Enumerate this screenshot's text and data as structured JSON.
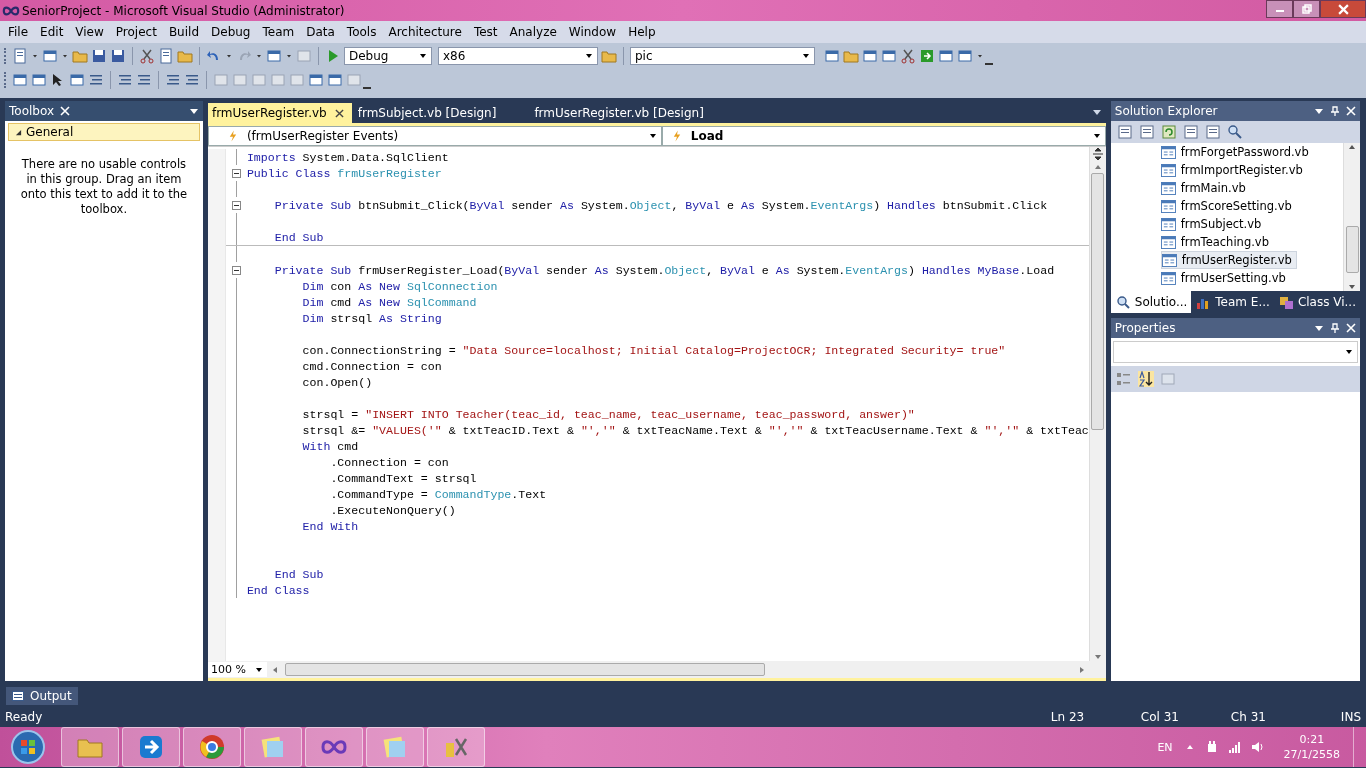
{
  "window": {
    "title": "SeniorProject - Microsoft Visual Studio (Administrator)"
  },
  "menu": [
    "File",
    "Edit",
    "View",
    "Project",
    "Build",
    "Debug",
    "Team",
    "Data",
    "Tools",
    "Architecture",
    "Test",
    "Analyze",
    "Window",
    "Help"
  ],
  "toolbar": {
    "configuration": "Debug",
    "platform": "x86",
    "find": "pic"
  },
  "toolbox": {
    "title": "Toolbox",
    "group": "General",
    "group_expanded": true,
    "message": "There are no usable controls in this group. Drag an item onto this text to add it to the toolbox."
  },
  "tabs": [
    {
      "label": "frmUserRegister.vb",
      "selected": true
    },
    {
      "label": "frmSubject.vb [Design]",
      "selected": false
    },
    {
      "label": "frmUserRegister.vb [Design]",
      "selected": false
    }
  ],
  "navigation": {
    "class_box": "(frmUserRegister Events)",
    "method_box": "Load"
  },
  "code": [
    {
      "fold": false,
      "tokens": [
        {
          "kind": "kw",
          "text": "Imports"
        },
        {
          "kind": "pl",
          "text": " System.Data.SqlClient"
        }
      ]
    },
    {
      "fold": true,
      "tokens": [
        {
          "kind": "kw",
          "text": "Public Class "
        },
        {
          "kind": "ty",
          "text": "frmUserRegister"
        }
      ]
    },
    {
      "fold": false
    },
    {
      "fold": true,
      "tokens": [
        {
          "kind": "kw",
          "text": "    Private Sub "
        },
        {
          "kind": "pl",
          "text": "btnSubmit_Click("
        },
        {
          "kind": "kw",
          "text": "ByVal"
        },
        {
          "kind": "pl",
          "text": " sender "
        },
        {
          "kind": "kw",
          "text": "As"
        },
        {
          "kind": "pl",
          "text": " System."
        },
        {
          "kind": "ty",
          "text": "Object"
        },
        {
          "kind": "pl",
          "text": ", "
        },
        {
          "kind": "kw",
          "text": "ByVal"
        },
        {
          "kind": "pl",
          "text": " e "
        },
        {
          "kind": "kw",
          "text": "As"
        },
        {
          "kind": "pl",
          "text": " System."
        },
        {
          "kind": "ty",
          "text": "EventArgs"
        },
        {
          "kind": "pl",
          "text": ") "
        },
        {
          "kind": "kw",
          "text": "Handles"
        },
        {
          "kind": "pl",
          "text": " btnSubmit.Click"
        }
      ]
    },
    {
      "fold": false
    },
    {
      "fold": false,
      "divider": true,
      "tokens": [
        {
          "kind": "kw",
          "text": "    End Sub"
        }
      ]
    },
    {
      "fold": false
    },
    {
      "fold": true,
      "tokens": [
        {
          "kind": "kw",
          "text": "    Private Sub "
        },
        {
          "kind": "pl",
          "text": "frmUserRegister_Load("
        },
        {
          "kind": "kw",
          "text": "ByVal"
        },
        {
          "kind": "pl",
          "text": " sender "
        },
        {
          "kind": "kw",
          "text": "As"
        },
        {
          "kind": "pl",
          "text": " System."
        },
        {
          "kind": "ty",
          "text": "Object"
        },
        {
          "kind": "pl",
          "text": ", "
        },
        {
          "kind": "kw",
          "text": "ByVal"
        },
        {
          "kind": "pl",
          "text": " e "
        },
        {
          "kind": "kw",
          "text": "As"
        },
        {
          "kind": "pl",
          "text": " System."
        },
        {
          "kind": "ty",
          "text": "EventArgs"
        },
        {
          "kind": "pl",
          "text": ") "
        },
        {
          "kind": "kw",
          "text": "Handles MyBase"
        },
        {
          "kind": "pl",
          "text": ".Load"
        }
      ]
    },
    {
      "fold": false,
      "tokens": [
        {
          "kind": "kw",
          "text": "        Dim"
        },
        {
          "kind": "pl",
          "text": " con "
        },
        {
          "kind": "kw",
          "text": "As New "
        },
        {
          "kind": "ty",
          "text": "SqlConnection"
        }
      ]
    },
    {
      "fold": false,
      "tokens": [
        {
          "kind": "kw",
          "text": "        Dim"
        },
        {
          "kind": "pl",
          "text": " cmd "
        },
        {
          "kind": "kw",
          "text": "As New "
        },
        {
          "kind": "ty",
          "text": "SqlCommand"
        }
      ]
    },
    {
      "fold": false,
      "tokens": [
        {
          "kind": "kw",
          "text": "        Dim"
        },
        {
          "kind": "pl",
          "text": " strsql "
        },
        {
          "kind": "kw",
          "text": "As String"
        }
      ]
    },
    {
      "fold": false
    },
    {
      "fold": false,
      "tokens": [
        {
          "kind": "pl",
          "text": "        con.ConnectionString = "
        },
        {
          "kind": "st",
          "text": "\"Data Source=localhost; Initial Catalog=ProjectOCR; Integrated Security= true\""
        }
      ]
    },
    {
      "fold": false,
      "tokens": [
        {
          "kind": "pl",
          "text": "        cmd.Connection = con"
        }
      ]
    },
    {
      "fold": false,
      "tokens": [
        {
          "kind": "pl",
          "text": "        con.Open()"
        }
      ]
    },
    {
      "fold": false
    },
    {
      "fold": false,
      "tokens": [
        {
          "kind": "pl",
          "text": "        strsql = "
        },
        {
          "kind": "st",
          "text": "\"INSERT INTO Teacher(teac_id, teac_name, teac_username, teac_password, answer)\""
        }
      ]
    },
    {
      "fold": false,
      "tokens": [
        {
          "kind": "pl",
          "text": "        strsql &= "
        },
        {
          "kind": "st",
          "text": "\"VALUES('\""
        },
        {
          "kind": "pl",
          "text": " & txtTeacID.Text & "
        },
        {
          "kind": "st",
          "text": "\"','\""
        },
        {
          "kind": "pl",
          "text": " & txtTeacName.Text & "
        },
        {
          "kind": "st",
          "text": "\"','\""
        },
        {
          "kind": "pl",
          "text": " & txtTeacUsername.Text & "
        },
        {
          "kind": "st",
          "text": "\"','\""
        },
        {
          "kind": "pl",
          "text": " & txtTeac"
        }
      ]
    },
    {
      "fold": false,
      "tokens": [
        {
          "kind": "kw",
          "text": "        With"
        },
        {
          "kind": "pl",
          "text": " cmd"
        }
      ]
    },
    {
      "fold": false,
      "tokens": [
        {
          "kind": "pl",
          "text": "            .Connection = con"
        }
      ]
    },
    {
      "fold": false,
      "tokens": [
        {
          "kind": "pl",
          "text": "            .CommandText = strsql"
        }
      ]
    },
    {
      "fold": false,
      "tokens": [
        {
          "kind": "pl",
          "text": "            .CommandType = "
        },
        {
          "kind": "ty",
          "text": "CommandType"
        },
        {
          "kind": "pl",
          "text": ".Text"
        }
      ]
    },
    {
      "fold": false,
      "tokens": [
        {
          "kind": "pl",
          "text": "            .ExecuteNonQuery()"
        }
      ]
    },
    {
      "fold": false,
      "tokens": [
        {
          "kind": "kw",
          "text": "        End With"
        }
      ]
    },
    {
      "fold": false
    },
    {
      "fold": false
    },
    {
      "fold": false,
      "tokens": [
        {
          "kind": "kw",
          "text": "    End Sub"
        }
      ]
    },
    {
      "fold": false,
      "tokens": [
        {
          "kind": "kw",
          "text": "End Class"
        }
      ]
    }
  ],
  "zoom": "100 %",
  "solution_explorer": {
    "title": "Solution Explorer",
    "items": [
      {
        "label": "frmForgetPassword.vb",
        "selected": false
      },
      {
        "label": "frmImportRegister.vb",
        "selected": false
      },
      {
        "label": "frmMain.vb",
        "selected": false
      },
      {
        "label": "frmScoreSetting.vb",
        "selected": false
      },
      {
        "label": "frmSubject.vb",
        "selected": false
      },
      {
        "label": "frmTeaching.vb",
        "selected": false
      },
      {
        "label": "frmUserRegister.vb",
        "selected": true
      },
      {
        "label": "frmUserSetting.vb",
        "selected": false
      }
    ],
    "tabs": [
      {
        "label": "Solutio...",
        "selected": true
      },
      {
        "label": "Team E...",
        "selected": false
      },
      {
        "label": "Class Vi...",
        "selected": false
      }
    ]
  },
  "properties": {
    "title": "Properties"
  },
  "output_tab": "Output",
  "status_bar": {
    "text": "Ready",
    "line": "Ln 23",
    "column": "Col 31",
    "character": "Ch 31",
    "mode": "INS"
  },
  "taskbar": {
    "language": "EN",
    "time": "0:21",
    "date": "27/1/2558"
  }
}
